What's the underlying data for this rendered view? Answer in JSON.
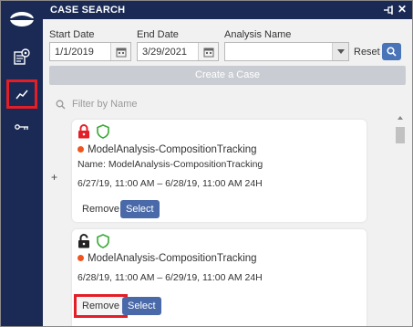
{
  "window": {
    "title": "CASE SEARCH",
    "close_glyph": "✕"
  },
  "rail": {
    "items": [
      "logo-icon",
      "document-settings-icon",
      "trend-chart-icon",
      "key-icon"
    ]
  },
  "form": {
    "start_date_label": "Start Date",
    "start_date_value": "1/1/2019",
    "end_date_label": "End Date",
    "end_date_value": "3/29/2021",
    "analysis_name_label": "Analysis Name",
    "analysis_name_value": "",
    "reset_label": "Reset",
    "create_case_label": "Create a Case",
    "filter_placeholder": "Filter by Name"
  },
  "plus_label": "+",
  "cards": [
    {
      "lock_state": "locked",
      "lock_color": "#e41e26",
      "title": "ModelAnalysis-CompositionTracking",
      "name_line": "Name: ModelAnalysis-CompositionTracking",
      "time_range": "6/27/19, 11:00 AM – 6/28/19, 11:00 AM 24H",
      "remove_label": "Remove",
      "select_label": "Select"
    },
    {
      "lock_state": "unlocked",
      "lock_color": "#222222",
      "title": "ModelAnalysis-CompositionTracking",
      "time_range": "6/28/19, 11:00 AM – 6/29/19, 11:00 AM 24H",
      "remove_label": "Remove",
      "select_label": "Select"
    }
  ],
  "colors": {
    "nav_bg": "#1a2a55",
    "accent_blue": "#4a69a8",
    "status_dot": "#f0541e",
    "shield_green": "#39a935",
    "highlight_red": "#e41e26"
  }
}
